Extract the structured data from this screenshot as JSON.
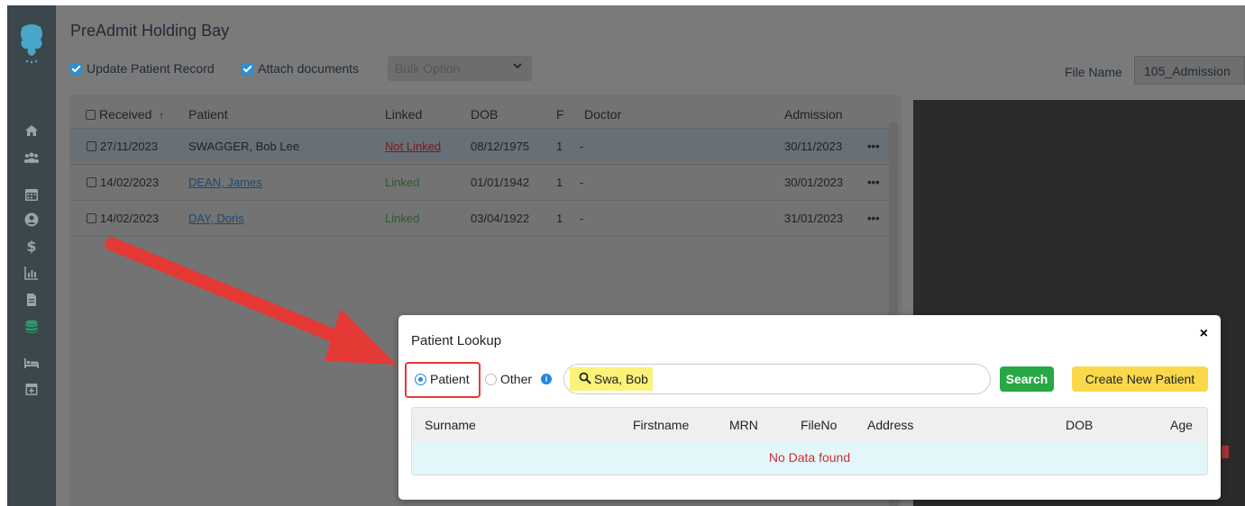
{
  "page": {
    "title": "PreAdmit Holding Bay"
  },
  "options": {
    "update_patient_record": "Update Patient Record",
    "attach_documents": "Attach documents",
    "bulk_option": "Bulk Option",
    "file_name_label": "File Name",
    "file_name_value": "105_Admission"
  },
  "table": {
    "columns": [
      "Received",
      "Patient",
      "Linked",
      "DOB",
      "F",
      "Doctor",
      "Admission"
    ],
    "sort_indicator": "↑",
    "rows": [
      {
        "received": "27/11/2023",
        "patient": "SWAGGER, Bob Lee",
        "linked": "Not Linked",
        "dob": "08/12/1975",
        "f": "1",
        "doctor": "-",
        "admission": "30/11/2023",
        "menu": "•••"
      },
      {
        "received": "14/02/2023",
        "patient": "DEAN, James",
        "linked": "Linked",
        "dob": "01/01/1942",
        "f": "1",
        "doctor": "-",
        "admission": "30/01/2023",
        "menu": "•••"
      },
      {
        "received": "14/02/2023",
        "patient": "DAY, Doris",
        "linked": "Linked",
        "dob": "03/04/1922",
        "f": "1",
        "doctor": "-",
        "admission": "31/01/2023",
        "menu": "•••"
      }
    ]
  },
  "modal": {
    "title": "Patient Lookup",
    "close": "×",
    "radio_patient": "Patient",
    "radio_other": "Other",
    "info": "i",
    "search_value": "Swa, Bob",
    "search_button": "Search",
    "create_button": "Create New Patient",
    "columns": [
      "Surname",
      "Firstname",
      "MRN",
      "FileNo",
      "Address",
      "DOB",
      "Age"
    ],
    "empty_message": "No Data found"
  },
  "sidebar": {
    "icons": [
      "home-icon",
      "users-icon",
      "calendar-icon",
      "user-circle-icon",
      "dollar-icon",
      "bar-chart-icon",
      "invoice-icon",
      "database-icon",
      "bed-icon",
      "calendar-plus-icon"
    ]
  },
  "colors": {
    "accent_blue": "#2d8fd0",
    "search_green": "#28a745",
    "create_yellow": "#f9d94a",
    "arrow_red": "#e53935",
    "no_data_red": "#d32f2f"
  }
}
